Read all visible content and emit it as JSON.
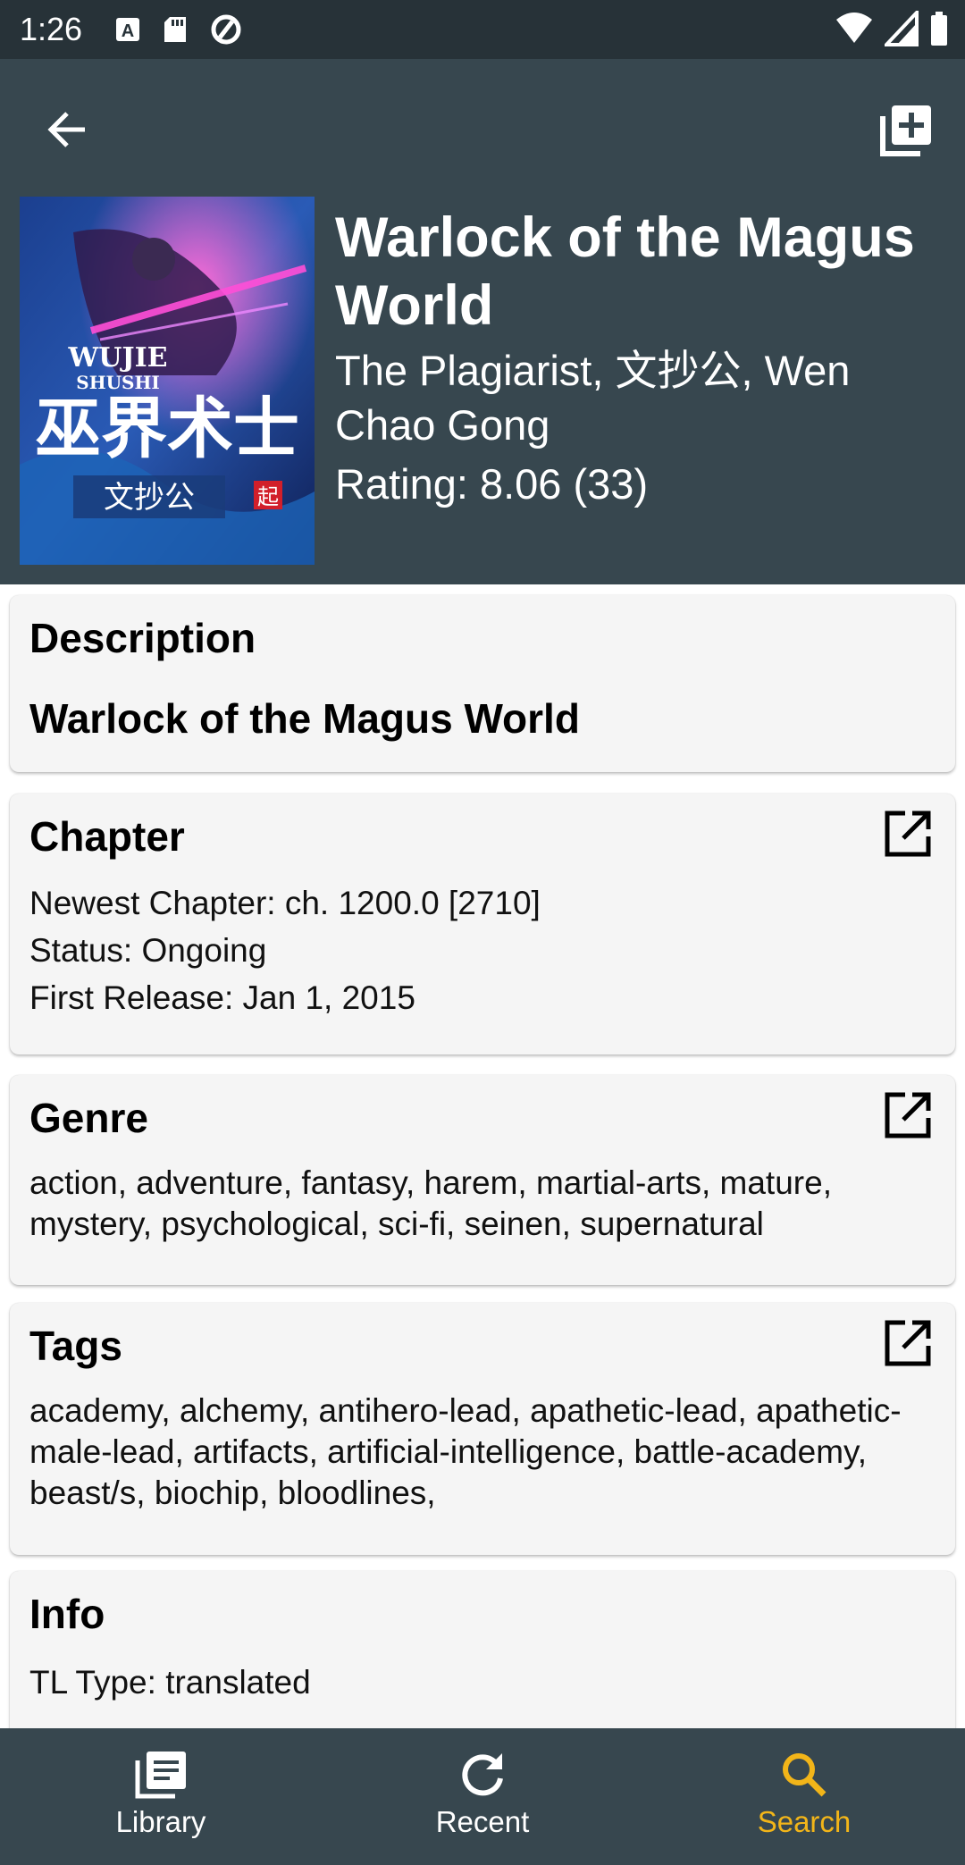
{
  "status": {
    "time": "1:26",
    "icons": [
      "a-box-icon",
      "sd-card-icon",
      "data-saver-icon",
      "wifi-icon",
      "signal-icon",
      "battery-icon"
    ]
  },
  "header": {
    "title": "Warlock of the Magus World",
    "authors": "The Plagiarist, 文抄公, Wen Chao Gong",
    "rating": "Rating: 8.06 (33)",
    "cover": {
      "line1": "WUJIE",
      "line2": "SHUSHI",
      "chinese_title": "巫界术士",
      "author_badge": "文抄公",
      "seal": "起"
    }
  },
  "description": {
    "heading": "Description",
    "text": "Warlock of the Magus World"
  },
  "chapter": {
    "heading": "Chapter",
    "newest": "Newest Chapter: ch. 1200.0 [2710]",
    "status": "Status: Ongoing",
    "first_release": "First Release: Jan 1, 2015"
  },
  "genre": {
    "heading": "Genre",
    "text": "action, adventure, fantasy, harem, martial-arts, mature, mystery, psychological, sci-fi, seinen, supernatural"
  },
  "tags": {
    "heading": "Tags",
    "text": "academy, alchemy, antihero-lead, apathetic-lead, apathetic-male-lead, artifacts, artificial-intelligence, battle-academy, beast/s, biochip, bloodlines,"
  },
  "info": {
    "heading": "Info",
    "tl_type": "TL Type: translated"
  },
  "nav": {
    "library": "Library",
    "recent": "Recent",
    "search": "Search",
    "active": "search"
  },
  "colors": {
    "status_bar": "#273238",
    "header": "#37474f",
    "accent": "#f2b519",
    "card": "#f5f5f5"
  }
}
